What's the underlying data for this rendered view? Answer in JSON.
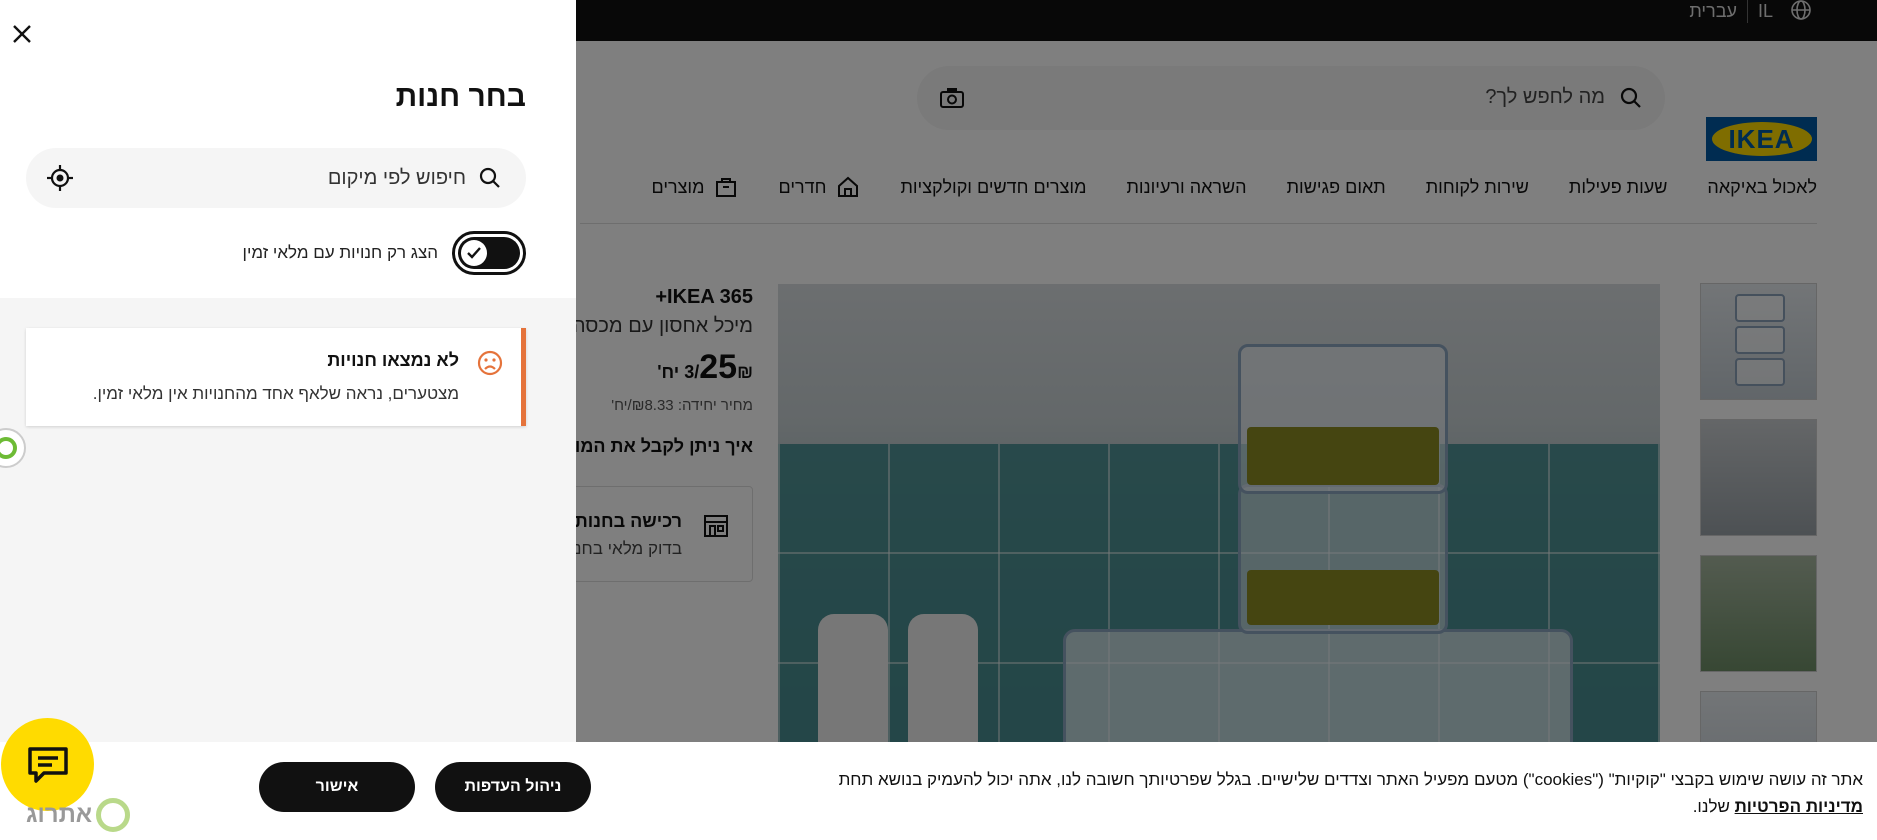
{
  "topbar": {
    "language": "עברית",
    "country": "IL"
  },
  "header": {
    "logo_text": "IKEA",
    "search_placeholder": "מה לחפש לך?",
    "nav": [
      {
        "label": "מוצרים",
        "icon": "products-icon"
      },
      {
        "label": "חדרים",
        "icon": "home-icon"
      },
      {
        "label": "מוצרים חדשים וקולקציות"
      },
      {
        "label": "השראה ורעיונות"
      },
      {
        "label": "תאום פגישות"
      },
      {
        "label": "שירות לקוחות"
      },
      {
        "label": "שעות פעילות"
      },
      {
        "label": "לאכול באיקאה"
      }
    ]
  },
  "product": {
    "brand": "IKEA 365+",
    "description": "מיכל אחסון עם מכסה",
    "price_number": "25",
    "price_unit": "₪/3 יח'",
    "unit_price": "מחיר יחידה: ₪8.33/יח'",
    "how_to_get": "איך ניתן לקבל את המוצר?",
    "store_pickup_title": "רכישה בחנות",
    "store_pickup_sub": "בדוק מלאי בחנות"
  },
  "panel": {
    "title": "בחר חנות",
    "search_placeholder": "חיפוש לפי מיקום",
    "toggle_label": "הצג רק חנויות עם מלאי זמין",
    "toggle_on": true,
    "alert_title": "לא נמצאו חנויות",
    "alert_text": "מצטערים, נראה שלאף אחד מהחנויות אין מלאי זמין."
  },
  "cookie": {
    "text_before": "אתר זה עושה שימוש בקבצי \"קוקיות\" (\"cookies\") מטעם מפעיל האתר וצדדים שלישיים. בגלל שפרטיותך חשובה לנו, אתה יכול להעמיק בנושא תחת ",
    "link": "מדיניות הפרטיות",
    "text_after": " שלנו.",
    "manage_button": "ניהול העדפות",
    "accept_button": "אישור"
  },
  "accessibility": {
    "label": "אתרוג"
  },
  "colors": {
    "accent": "#e5733b",
    "chat": "#ffdb00",
    "ikea_blue": "#0058a3",
    "ikea_yellow": "#ffdb00"
  }
}
